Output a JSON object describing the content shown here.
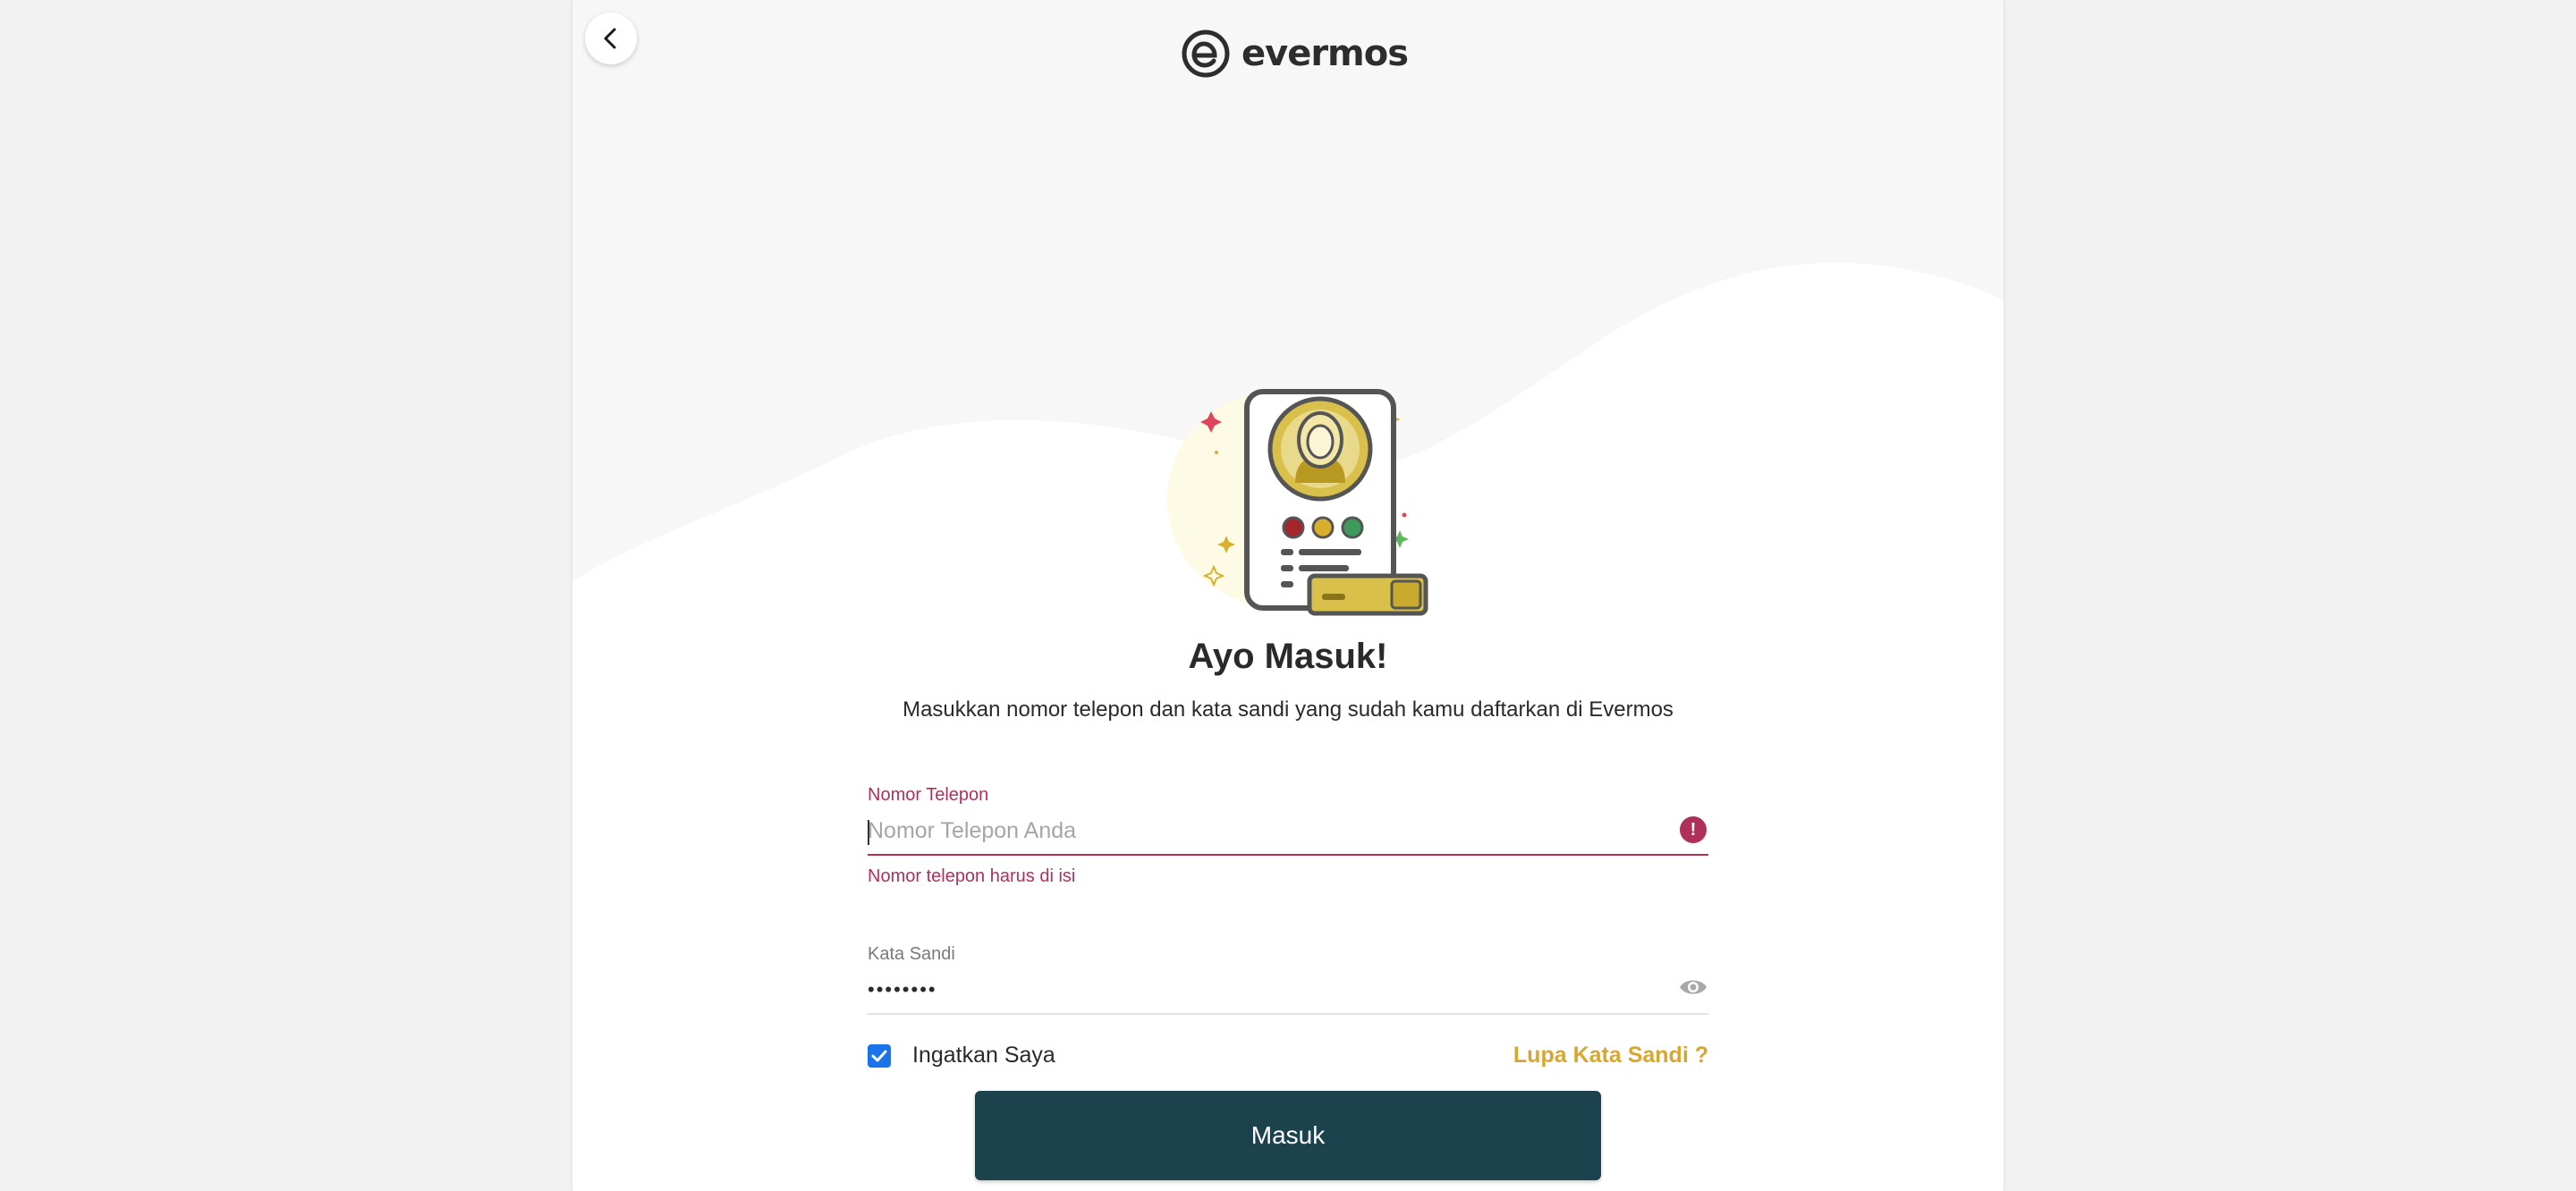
{
  "logo": {
    "text": "evermos"
  },
  "heading": {
    "title": "Ayo Masuk!",
    "subtitle": "Masukkan nomor telepon dan kata sandi yang sudah kamu daftarkan di Evermos"
  },
  "phone": {
    "label": "Nomor Telepon",
    "placeholder": "Nomor Telepon Anda",
    "value": "",
    "error": "Nomor telepon harus di isi"
  },
  "password": {
    "label": "Kata Sandi",
    "value": "••••••••"
  },
  "remember": {
    "label": "Ingatkan Saya",
    "checked": true
  },
  "forgot": {
    "label": "Lupa Kata Sandi ?"
  },
  "submit": {
    "label": "Masuk"
  },
  "icons": {
    "back": "arrow-left-icon",
    "error": "alert-circle-icon",
    "eye": "eye-icon",
    "check": "check-icon"
  },
  "colors": {
    "primary": "#1c424e",
    "error": "#b0305c",
    "accent": "#d9a62e",
    "checkbox": "#1a73e8"
  }
}
